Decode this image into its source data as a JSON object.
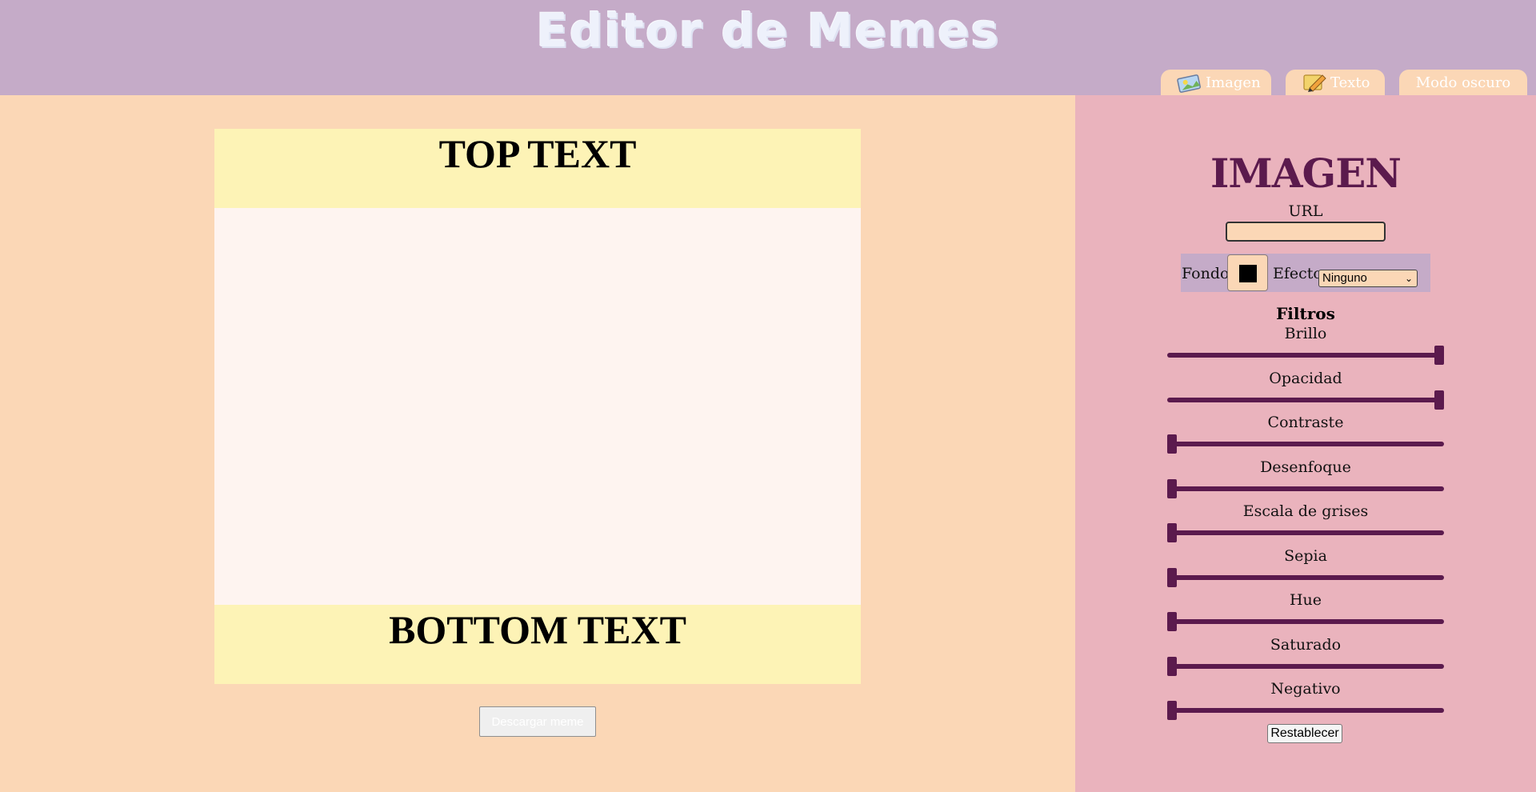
{
  "header": {
    "title": "Editor de Memes",
    "tabs": [
      {
        "label": "Imagen",
        "icon": "image-icon"
      },
      {
        "label": "Texto",
        "icon": "pencil-icon"
      },
      {
        "label": "Modo oscuro"
      }
    ]
  },
  "meme": {
    "top_text": "TOP TEXT",
    "bottom_text": "BOTTOM TEXT",
    "download_label": "Descargar meme"
  },
  "panel": {
    "title": "IMAGEN",
    "url_label": "URL",
    "url_value": "",
    "fondo_label": "Fondo",
    "fondo_color": "#000000",
    "efecto_label": "Efecto",
    "efecto_value": "Ninguno",
    "filtros_title": "Filtros",
    "filters": [
      {
        "label": "Brillo",
        "value": 1.0
      },
      {
        "label": "Opacidad",
        "value": 1.0
      },
      {
        "label": "Contraste",
        "value": 0.0
      },
      {
        "label": "Desenfoque",
        "value": 0.0
      },
      {
        "label": "Escala de grises",
        "value": 0.0
      },
      {
        "label": "Sepia",
        "value": 0.0
      },
      {
        "label": "Hue",
        "value": 0.0
      },
      {
        "label": "Saturado",
        "value": 0.0
      },
      {
        "label": "Negativo",
        "value": 0.0
      }
    ],
    "reset_label": "Restablecer"
  },
  "colors": {
    "header_bg": "#c5abc8",
    "canvas_bg": "#fbd7b6",
    "panel_bg": "#eab3bd",
    "meme_text_bg": "#fdf3b6",
    "accent": "#5b1a4d"
  }
}
